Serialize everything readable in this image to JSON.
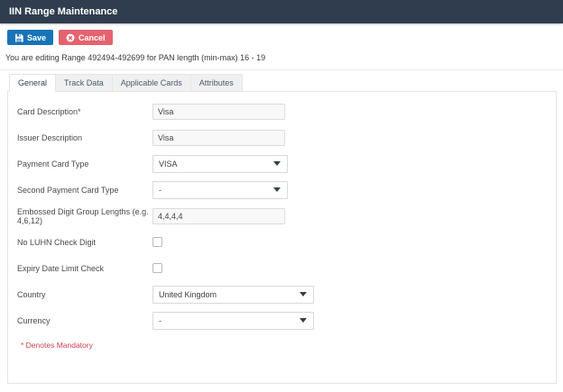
{
  "header": {
    "title": "IIN Range Maintenance"
  },
  "toolbar": {
    "save_label": "Save",
    "cancel_label": "Cancel"
  },
  "info_text": "You are editing Range 492494-492699 for PAN length (min-max) 16 - 19",
  "tabs": [
    {
      "label": "General",
      "active": true
    },
    {
      "label": "Track Data",
      "active": false
    },
    {
      "label": "Applicable Cards",
      "active": false
    },
    {
      "label": "Attributes",
      "active": false
    }
  ],
  "form": {
    "fields": [
      {
        "name": "card-description",
        "label": "Card Description*",
        "type": "text",
        "value": "Visa"
      },
      {
        "name": "issuer-description",
        "label": "Issuer Description",
        "type": "text",
        "value": "Visa"
      },
      {
        "name": "payment-card-type",
        "label": "Payment Card Type",
        "type": "select",
        "value": "VISA"
      },
      {
        "name": "second-payment-card-type",
        "label": "Second Payment Card Type",
        "type": "select",
        "value": "-"
      },
      {
        "name": "embossed-digit-group-lengths",
        "label": "Embossed Digit Group Lengths (e.g. 4,6,12)",
        "type": "text",
        "value": "4,4,4,4"
      },
      {
        "name": "no-luhn-check-digit",
        "label": "No LUHN Check Digit",
        "type": "checkbox",
        "checked": false
      },
      {
        "name": "expiry-date-limit-check",
        "label": "Expiry Date Limit Check",
        "type": "checkbox",
        "checked": false
      },
      {
        "name": "country",
        "label": "Country",
        "type": "select",
        "value": "United Kingdom",
        "wide": true
      },
      {
        "name": "currency",
        "label": "Currency",
        "type": "select",
        "value": "-",
        "wide": true
      }
    ],
    "footnote": "* Denotes Mandatory"
  },
  "icons": {
    "save_button": "floppy-disk-icon",
    "cancel_button": "circle-x-icon",
    "select": "chevron-down-icon"
  },
  "colors": {
    "header_bg": "#2f3d4e",
    "save_bg": "#1774b9",
    "cancel_bg": "#e5636e",
    "mandatory_text": "#cc4250",
    "input_bg": "#f8f8f8",
    "border": "#e4e4e4"
  }
}
